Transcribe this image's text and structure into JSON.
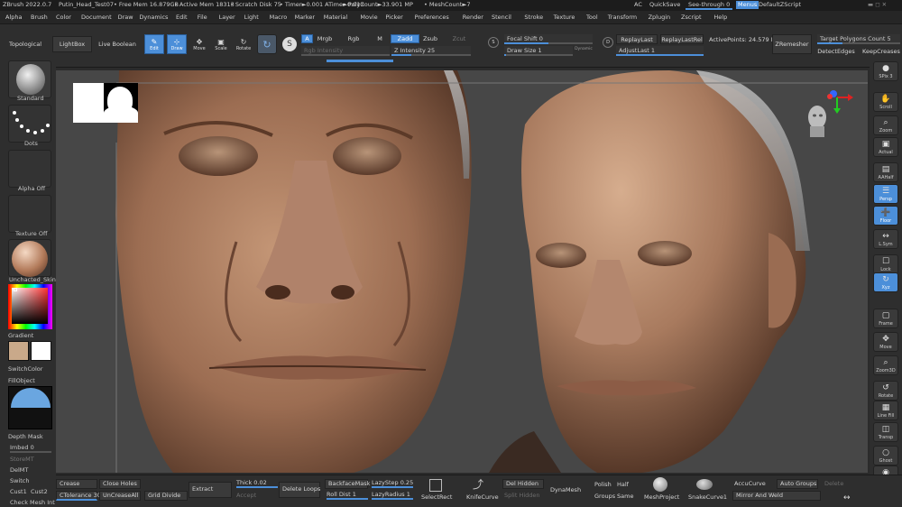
{
  "titlebar": {
    "app": "ZBrush 2022.0.7",
    "document": "Putin_Head_Test07",
    "free_mem": "• Free Mem 16.879GB",
    "active_mem": "• Active Mem 18313",
    "scratch": "• Scratch Disk 75",
    "timer": "• Timer►0.001 ATime►0.013",
    "polycount": "• PolyCount►33.901 MP",
    "meshcount": "• MeshCount►7",
    "ac": "AC",
    "quicksave": "QuickSave",
    "seethrough": "See-through  0",
    "menus": "Menus",
    "defaultzscript": "DefaultZScript"
  },
  "menu": [
    "Alpha",
    "Brush",
    "Color",
    "Document",
    "Draw",
    "Dynamics",
    "Edit",
    "File",
    "Layer",
    "Light",
    "Macro",
    "Marker",
    "Material",
    "Movie",
    "Picker",
    "Preferences",
    "Render",
    "Stencil",
    "Stroke",
    "Texture",
    "Tool",
    "Transform",
    "Zplugin",
    "Zscript",
    "Help"
  ],
  "shelf": {
    "topological": "Topological",
    "lightbox": "LightBox",
    "live_boolean": "Live Boolean",
    "edit": "Edit",
    "draw": "Draw",
    "move": "Move",
    "scale": "Scale",
    "rotate": "Rotate",
    "a": "A",
    "mrgb": "Mrgb",
    "rgb": "Rgb",
    "m": "M",
    "zadd": "Zadd",
    "zsub": "Zsub",
    "zcut": "Zcut",
    "rgb_intensity": "Rgb Intensity",
    "z_intensity": "Z Intensity 25",
    "focal_shift": "Focal Shift 0",
    "draw_size": "Draw Size 1",
    "dynamic": "Dynamic",
    "replaylast": "ReplayLast",
    "replaylastrel": "ReplayLastRel",
    "adjustlast": "AdjustLast 1",
    "activepoints": "ActivePoints: 24.579 Mil",
    "zremesher": "ZRemesher",
    "target_polygons": "Target Polygons Count 5",
    "detectedges": "DetectEdges",
    "keepcreases": "KeepCreases"
  },
  "left": {
    "standard": "Standard",
    "dots": "Dots",
    "alpha_off": "Alpha Off",
    "texture_off": "Texture Off",
    "material": "Unchacted_Skin",
    "gradient": "Gradient",
    "switchcolor": "SwitchColor",
    "fillobject": "FillObject",
    "depth_mask": "Depth Mask",
    "imbed": "Imbed 0",
    "storemt": "StoreMT",
    "delmt": "DelMT",
    "switch": "Switch",
    "cust1": "Cust1",
    "cust2": "Cust2",
    "check_mesh": "Check Mesh Int"
  },
  "right": [
    {
      "label": "SPix 3",
      "glyph": "●",
      "active": false
    },
    {
      "label": "Scroll",
      "glyph": "✋",
      "active": false
    },
    {
      "label": "Zoom",
      "glyph": "⌕",
      "active": false
    },
    {
      "label": "Actual",
      "glyph": "▣",
      "active": false
    },
    {
      "label": "AAHalf",
      "glyph": "▤",
      "active": false
    },
    {
      "label": "Persp",
      "glyph": "☰",
      "active": true
    },
    {
      "label": "Floor",
      "glyph": "➕",
      "active": true
    },
    {
      "label": "L.Sym",
      "glyph": "↔",
      "active": false
    },
    {
      "label": "Lock",
      "glyph": "☐",
      "active": false
    },
    {
      "label": "Xyz",
      "glyph": "↻",
      "active": true
    },
    {
      "label": "Frame",
      "glyph": "▢",
      "active": false
    },
    {
      "label": "Move",
      "glyph": "✥",
      "active": false
    },
    {
      "label": "Zoom3D",
      "glyph": "⌕",
      "active": false
    },
    {
      "label": "Rotate",
      "glyph": "↺",
      "active": false
    },
    {
      "label": "Line Fill",
      "glyph": "▦",
      "active": false
    },
    {
      "label": "Transp",
      "glyph": "◫",
      "active": false
    },
    {
      "label": "Ghost",
      "glyph": "○",
      "active": false
    },
    {
      "label": "Solo",
      "glyph": "◉",
      "active": false
    }
  ],
  "bottom": {
    "crease": "Crease",
    "close_holes": "Close Holes",
    "ctolerance": "CTolerance 30",
    "uncreaseall": "UnCreaseAll",
    "grid_divide": "Grid Divide",
    "extract": "Extract",
    "thick": "Thick 0.02",
    "accept": "Accept",
    "delete_loops": "Delete Loops",
    "backfacemask": "BackfaceMask",
    "roll_dist": "Roll Dist 1",
    "lazystep": "LazyStep 0.25",
    "lazyradius": "LazyRadius 1",
    "selectrect": "SelectRect",
    "knifecurve": "KnifeCurve",
    "del_hidden": "Del Hidden",
    "split_hidden": "Split Hidden",
    "dynamesh": "DynaMesh",
    "polish": "Polish",
    "groups": "Groups",
    "half": "Half",
    "same": "Same",
    "meshproject": "MeshProject",
    "snakecurve": "SnakeCurve1",
    "accucurve": "AccuCurve",
    "auto_groups": "Auto Groups",
    "delete": "Delete",
    "mirror_weld": "Mirror And Weld"
  },
  "colors": {
    "accent": "#4c8fd9",
    "panel": "#2e2e2e",
    "viewport": "#474747",
    "skin": "#a87a5e",
    "main_color": "#c9a98a"
  }
}
